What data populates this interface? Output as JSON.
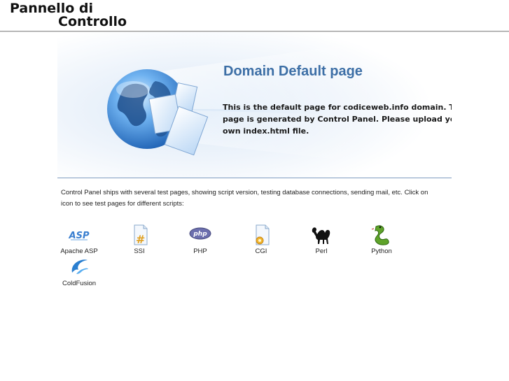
{
  "header": {
    "logo_line1": "Pannello di",
    "logo_line2": "Controllo"
  },
  "hero": {
    "title": "Domain Default page",
    "description_line1": "This is the default page for codiceweb.info domain. This",
    "description_line2": "page is generated by Control Panel. Please upload your",
    "description_line3": "own index.html file."
  },
  "intro": {
    "line1": "Control Panel ships with several test pages, showing script version, testing database connections, sending mail, etc. Click on",
    "line2": "icon to see test pages for different scripts:"
  },
  "scripts": [
    {
      "label": "Apache ASP",
      "icon": "asp-icon"
    },
    {
      "label": "SSI",
      "icon": "ssi-icon"
    },
    {
      "label": "PHP",
      "icon": "php-icon"
    },
    {
      "label": "CGI",
      "icon": "cgi-icon"
    },
    {
      "label": "Perl",
      "icon": "perl-camel-icon"
    },
    {
      "label": "Python",
      "icon": "python-snake-icon"
    },
    {
      "label": "ColdFusion",
      "icon": "coldfusion-icon"
    }
  ],
  "colors": {
    "title_blue": "#3d6fa6",
    "rule_blue": "#7f9cc0"
  }
}
